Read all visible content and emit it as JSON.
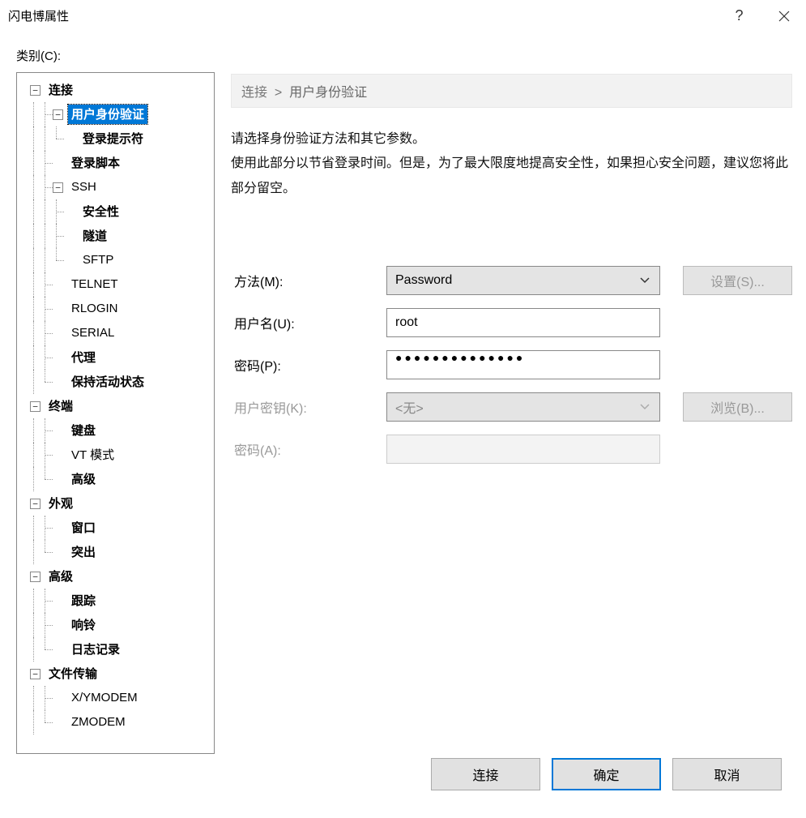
{
  "window": {
    "title": "闪电博属性"
  },
  "category_label": "类别(C):",
  "tree": {
    "connection": "连接",
    "user_auth": "用户身份验证",
    "login_prompt": "登录提示符",
    "login_script": "登录脚本",
    "ssh": "SSH",
    "security": "安全性",
    "tunnel": "隧道",
    "sftp": "SFTP",
    "telnet": "TELNET",
    "rlogin": "RLOGIN",
    "serial": "SERIAL",
    "proxy": "代理",
    "keepalive": "保持活动状态",
    "terminal": "终端",
    "keyboard": "键盘",
    "vt_mode": "VT 模式",
    "advanced2": "高级",
    "appearance": "外观",
    "window": "窗口",
    "highlight": "突出",
    "advanced": "高级",
    "trace": "跟踪",
    "bell": "响铃",
    "logging": "日志记录",
    "file_transfer": "文件传输",
    "xymodem": "X/YMODEM",
    "zmodem": "ZMODEM"
  },
  "breadcrumb": {
    "root": "连接",
    "sep": ">",
    "current": "用户身份验证"
  },
  "desc": {
    "line1": "请选择身份验证方法和其它参数。",
    "line2": "使用此部分以节省登录时间。但是，为了最大限度地提高安全性，如果担心安全问题，建议您将此部分留空。"
  },
  "form": {
    "method_label": "方法(M):",
    "method_value": "Password",
    "settings_btn": "设置(S)...",
    "username_label": "用户名(U):",
    "username_value": "root",
    "password_label": "密码(P):",
    "password_value": "●●●●●●●●●●●●●●",
    "userkey_label": "用户密钥(K):",
    "userkey_value": "<无>",
    "browse_btn": "浏览(B)...",
    "passphrase_label": "密码(A):"
  },
  "footer": {
    "connect": "连接",
    "ok": "确定",
    "cancel": "取消"
  }
}
